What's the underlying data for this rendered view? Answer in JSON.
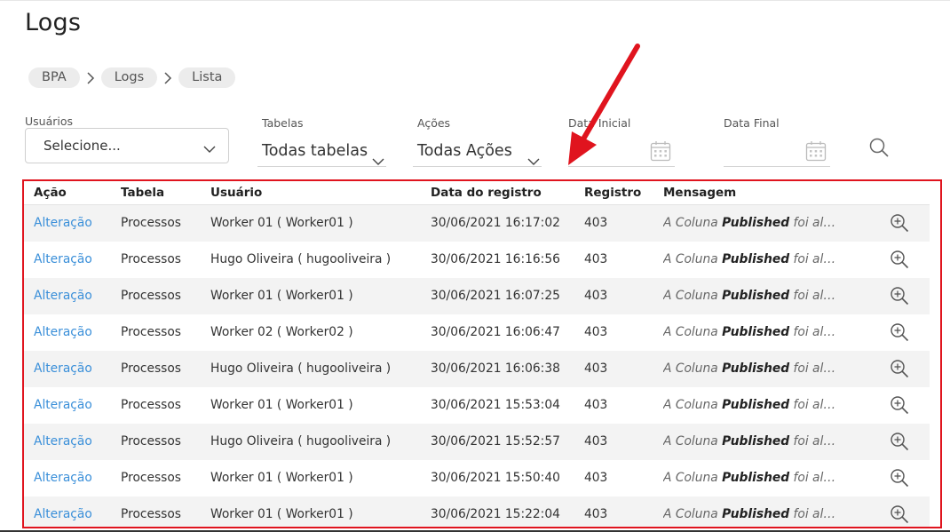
{
  "page_title": "Logs",
  "breadcrumb": [
    "BPA",
    "Logs",
    "Lista"
  ],
  "filters": {
    "usuarios": {
      "label": "Usuários",
      "value": "Selecione..."
    },
    "tabelas": {
      "label": "Tabelas",
      "value": "Todas tabelas"
    },
    "acoes": {
      "label": "Ações",
      "value": "Todas Ações"
    },
    "data_inicial": {
      "label": "Data Inicial",
      "value": ""
    },
    "data_final": {
      "label": "Data Final",
      "value": ""
    }
  },
  "icons": {
    "search": "search-icon",
    "calendar": "calendar-icon",
    "chevron": "chevron-down-icon",
    "row_action": "zoom-in-icon"
  },
  "colors": {
    "link": "#3a8fd9",
    "annotation": "#e0141e",
    "row_alt": "#f3f3f3"
  },
  "table": {
    "headers": [
      "Ação",
      "Tabela",
      "Usuário",
      "Data do registro",
      "Registro",
      "Mensagem"
    ],
    "rows": [
      {
        "acao": "Alteração",
        "tabela": "Processos",
        "usuario": "Worker 01 ( Worker01 )",
        "data": "30/06/2021 16:17:02",
        "registro": "403",
        "msg_pre": "A Coluna",
        "msg_bold": "Published",
        "msg_post": "foi altera..."
      },
      {
        "acao": "Alteração",
        "tabela": "Processos",
        "usuario": "Hugo Oliveira ( hugooliveira )",
        "data": "30/06/2021 16:16:56",
        "registro": "403",
        "msg_pre": "A Coluna",
        "msg_bold": "Published",
        "msg_post": "foi altera..."
      },
      {
        "acao": "Alteração",
        "tabela": "Processos",
        "usuario": "Worker 01 ( Worker01 )",
        "data": "30/06/2021 16:07:25",
        "registro": "403",
        "msg_pre": "A Coluna",
        "msg_bold": "Published",
        "msg_post": "foi altera..."
      },
      {
        "acao": "Alteração",
        "tabela": "Processos",
        "usuario": "Worker 02 ( Worker02 )",
        "data": "30/06/2021 16:06:47",
        "registro": "403",
        "msg_pre": "A Coluna",
        "msg_bold": "Published",
        "msg_post": "foi altera..."
      },
      {
        "acao": "Alteração",
        "tabela": "Processos",
        "usuario": "Hugo Oliveira ( hugooliveira )",
        "data": "30/06/2021 16:06:38",
        "registro": "403",
        "msg_pre": "A Coluna",
        "msg_bold": "Published",
        "msg_post": "foi altera..."
      },
      {
        "acao": "Alteração",
        "tabela": "Processos",
        "usuario": "Worker 01 ( Worker01 )",
        "data": "30/06/2021 15:53:04",
        "registro": "403",
        "msg_pre": "A Coluna",
        "msg_bold": "Published",
        "msg_post": "foi altera..."
      },
      {
        "acao": "Alteração",
        "tabela": "Processos",
        "usuario": "Hugo Oliveira ( hugooliveira )",
        "data": "30/06/2021 15:52:57",
        "registro": "403",
        "msg_pre": "A Coluna",
        "msg_bold": "Published",
        "msg_post": "foi altera..."
      },
      {
        "acao": "Alteração",
        "tabela": "Processos",
        "usuario": "Worker 01 ( Worker01 )",
        "data": "30/06/2021 15:50:40",
        "registro": "403",
        "msg_pre": "A Coluna",
        "msg_bold": "Published",
        "msg_post": "foi altera..."
      },
      {
        "acao": "Alteração",
        "tabela": "Processos",
        "usuario": "Worker 01 ( Worker01 )",
        "data": "30/06/2021 15:22:04",
        "registro": "403",
        "msg_pre": "A Coluna",
        "msg_bold": "Published",
        "msg_post": "foi altera..."
      }
    ]
  }
}
